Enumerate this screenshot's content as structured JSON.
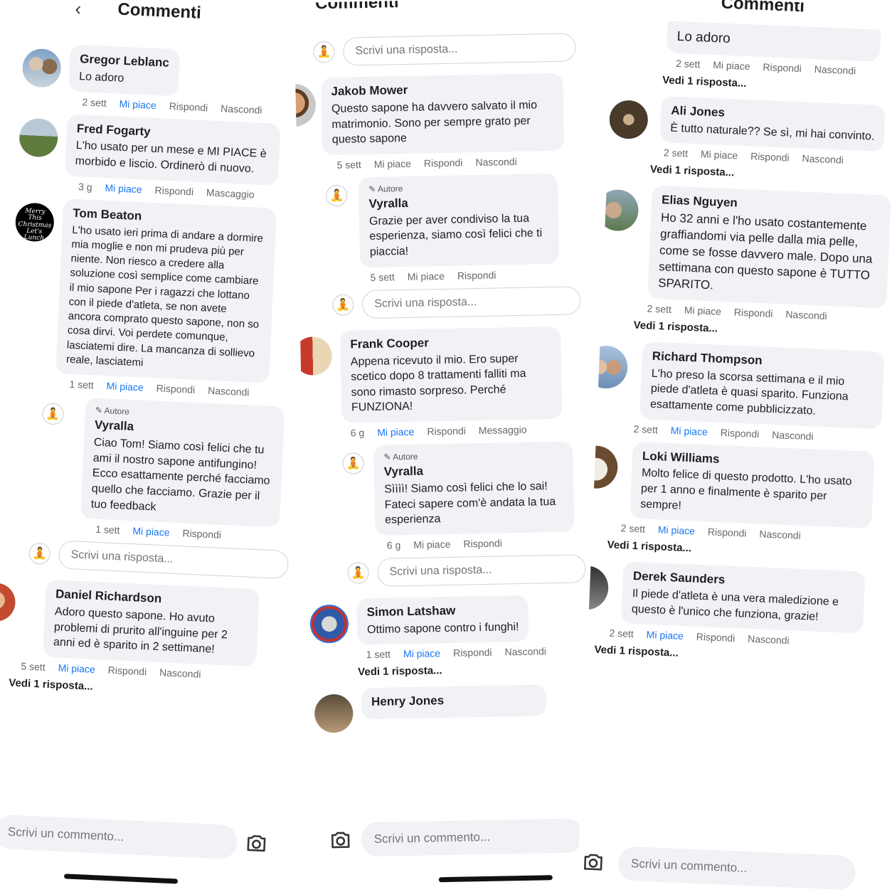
{
  "header": {
    "back_icon": "chevron-left-icon",
    "title": "Commenti"
  },
  "actions": {
    "like": "Mi piace",
    "reply": "Rispondi",
    "hide": "Nascondi",
    "message": "Messaggio",
    "massage": "Mascaggio",
    "see_reply": "Vedi 1 risposta..."
  },
  "reply_placeholder": "Scrivi una risposta...",
  "comment_placeholder": "Scrivi un commento...",
  "author_tag": "Autore",
  "tom_avatar_text": "Merry This Christmas Let's Lunch",
  "left": {
    "comments": [
      {
        "name": "Gregor Leblanc",
        "text": "Lo adoro",
        "age": "2 sett"
      },
      {
        "name": "Fred Fogarty",
        "text": "L'ho usato per un mese e MI PIACE è morbido e liscio. Ordinerò di nuovo.",
        "age": "3 g"
      },
      {
        "name": "Tom Beaton",
        "text": "L'ho usato ieri prima di andare a dormire mia moglie e non mi prudeva più per niente. Non riesco a credere alla soluzione così semplice come cambiare il mio sapone Per i ragazzi che lottano con il piede d'atleta, se non avete ancora comprato questo sapone, non so cosa dirvi. Voi perdete comunque, lasciatemi dire. La mancanza di sollievo reale, lasciatemi",
        "age": "1 sett"
      },
      {
        "name": "Daniel Richardson",
        "text": "Adoro questo sapone. Ho avuto problemi di prurito all'inguine per 2 anni ed è sparito in 2 settimane!",
        "age": "5 sett"
      }
    ],
    "reply": {
      "name": "Vyralla",
      "text": "Ciao Tom! Siamo così felici che tu ami il nostro sapone antifungino! Ecco esattamente perché facciamo quello che facciamo. Grazie per il tuo feedback",
      "age": "1 sett"
    }
  },
  "middle": {
    "comments": [
      {
        "name": "Jakob Mower",
        "text": "Questo sapone ha davvero salvato il mio matrimonio. Sono per sempre grato per questo sapone",
        "age": "5 sett"
      },
      {
        "name": "Frank Cooper",
        "text": "Appena ricevuto il mio. Ero super scetico dopo 8 trattamenti falliti ma sono rimasto sorpreso. Perché FUNZIONA!",
        "age": "6 g"
      },
      {
        "name": "Simon Latshaw",
        "text": "Ottimo sapone contro i funghi!",
        "age": "1 sett"
      },
      {
        "name": "Henry Jones",
        "text": "",
        "age": ""
      }
    ],
    "replies": [
      {
        "name": "Vyralla",
        "text": "Grazie per aver condiviso la tua esperienza, siamo così felici che ti piaccia!",
        "age": "5 sett"
      },
      {
        "name": "Vyralla",
        "text": "Sìììì! Siamo così felici che lo sai! Fateci sapere com'è andata la tua esperienza",
        "age": "6 g"
      }
    ]
  },
  "right": {
    "comments": [
      {
        "name": "",
        "text": "Lo adoro",
        "age": "2 sett"
      },
      {
        "name": "Ali Jones",
        "text": "È tutto naturale?? Se sì, mi hai convinto.",
        "age": "2 sett"
      },
      {
        "name": "Elias Nguyen",
        "text": "Ho 32 anni e l'ho usato costantemente graffiandomi via pelle dalla mia pelle, come se fosse davvero male. Dopo una settimana con questo sapone è TUTTO SPARITO.",
        "age": "2 sett"
      },
      {
        "name": "Richard Thompson",
        "text": "L'ho preso la scorsa settimana e il mio piede d'atleta è quasi sparito. Funziona esattamente come pubblicizzato.",
        "age": "2 sett"
      },
      {
        "name": "Loki Williams",
        "text": "Molto felice di questo prodotto. L'ho usato per 1 anno e finalmente è sparito per sempre!",
        "age": "2 sett"
      },
      {
        "name": "Derek Saunders",
        "text": "Il piede d'atleta è una vera maledizione e questo è l'unico che funziona, grazie!",
        "age": "2 sett"
      }
    ]
  },
  "icons": {
    "back": "chevron-left-icon",
    "camera": "camera-icon",
    "page_avatar": "meditation-figure-icon",
    "edit": "pencil-icon"
  }
}
